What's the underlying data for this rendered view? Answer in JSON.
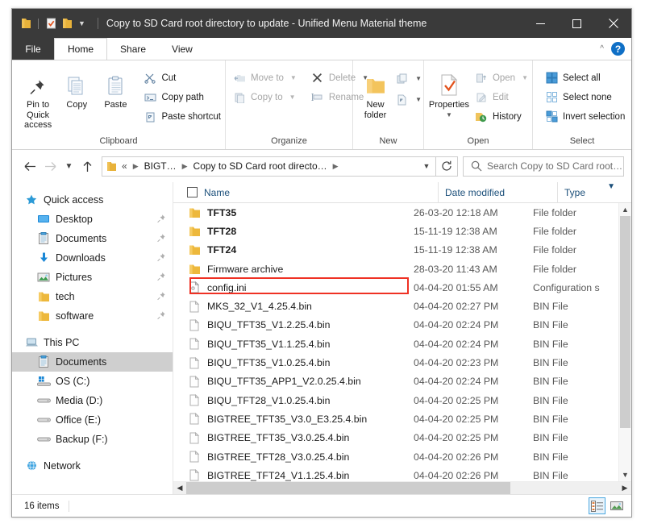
{
  "window": {
    "title": "Copy to SD Card root directory to update - Unified Menu Material theme",
    "quick_access_icons": [
      "folder-icon",
      "properties-icon",
      "new-folder-icon",
      "customize-qat-chevron-icon"
    ],
    "buttons": {
      "minimize": "minimize-button",
      "maximize": "maximize-button",
      "close": "close-button"
    }
  },
  "ribbon": {
    "tabs": [
      {
        "label": "File"
      },
      {
        "label": "Home"
      },
      {
        "label": "Share"
      },
      {
        "label": "View"
      }
    ],
    "collapse_label": "^",
    "help_label": "?",
    "groups": [
      {
        "label": "Clipboard",
        "big": [
          {
            "label": "Pin to Quick\naccess",
            "line1": "Pin to Quick",
            "line2": "access",
            "icon": "pin-icon"
          },
          {
            "label": "Copy",
            "line1": "Copy",
            "line2": "",
            "icon": "copy-icon"
          },
          {
            "label": "Paste",
            "line1": "Paste",
            "line2": "",
            "icon": "paste-icon"
          }
        ],
        "small": [
          {
            "label": "Cut",
            "icon": "scissors-icon",
            "disabled": false
          },
          {
            "label": "Copy path",
            "icon": "copy-path-icon",
            "disabled": false
          },
          {
            "label": "Paste shortcut",
            "icon": "paste-shortcut-icon",
            "disabled": false
          }
        ]
      },
      {
        "label": "Organize",
        "small_left": [
          {
            "label": "Move to",
            "icon": "move-to-icon",
            "dropdown": true,
            "disabled": true
          },
          {
            "label": "Copy to",
            "icon": "copy-to-icon",
            "dropdown": true,
            "disabled": true
          }
        ],
        "small_right": [
          {
            "label": "Delete",
            "icon": "delete-x-icon",
            "dropdown": true,
            "disabled": true
          },
          {
            "label": "Rename",
            "icon": "rename-icon",
            "dropdown": false,
            "disabled": true
          }
        ]
      },
      {
        "label": "New",
        "big": [
          {
            "line1": "New",
            "line2": "folder",
            "icon": "new-folder-icon"
          }
        ],
        "split": [
          {
            "icon": "new-item-icon",
            "dropdown": true
          },
          {
            "icon": "easy-access-icon",
            "dropdown": true
          }
        ]
      },
      {
        "label": "Open",
        "big": [
          {
            "line1": "Properties",
            "line2": "",
            "icon": "properties-icon",
            "dropdown": true
          }
        ],
        "small": [
          {
            "label": "Open",
            "icon": "open-icon",
            "dropdown": true,
            "disabled": true
          },
          {
            "label": "Edit",
            "icon": "edit-icon",
            "dropdown": false,
            "disabled": true
          },
          {
            "label": "History",
            "icon": "history-icon",
            "dropdown": false,
            "disabled": false
          }
        ]
      },
      {
        "label": "Select",
        "small": [
          {
            "label": "Select all",
            "icon": "select-all-icon"
          },
          {
            "label": "Select none",
            "icon": "select-none-icon"
          },
          {
            "label": "Invert selection",
            "icon": "invert-selection-icon"
          }
        ]
      }
    ]
  },
  "addressbar": {
    "back": "back-arrow-icon",
    "forward": "forward-arrow-icon",
    "recent": "recent-locations-chevron-icon",
    "up": "up-arrow-icon",
    "folder_icon": "folder-icon",
    "overflow": "«",
    "crumbs": [
      "BIGT…",
      "Copy to SD Card root directo…"
    ],
    "dropdown": "address-dropdown-icon",
    "refresh": "refresh-icon",
    "search": {
      "placeholder": "Search Copy to SD Card root…",
      "icon": "search-icon"
    }
  },
  "navpane": {
    "items": [
      {
        "label": "Quick access",
        "icon": "quick-access-star-icon",
        "level": 0,
        "pinned": false,
        "selected": false
      },
      {
        "label": "Desktop",
        "icon": "desktop-icon",
        "level": 1,
        "pinned": true,
        "selected": false
      },
      {
        "label": "Documents",
        "icon": "documents-icon",
        "level": 1,
        "pinned": true,
        "selected": false
      },
      {
        "label": "Downloads",
        "icon": "downloads-icon",
        "level": 1,
        "pinned": true,
        "selected": false
      },
      {
        "label": "Pictures",
        "icon": "pictures-icon",
        "level": 1,
        "pinned": true,
        "selected": false
      },
      {
        "label": "tech",
        "icon": "folder-icon",
        "level": 1,
        "pinned": true,
        "selected": false
      },
      {
        "label": "software",
        "icon": "folder-icon",
        "level": 1,
        "pinned": true,
        "selected": false
      },
      {
        "gap": true
      },
      {
        "label": "This PC",
        "icon": "this-pc-icon",
        "level": 0,
        "pinned": false,
        "selected": false
      },
      {
        "label": "Documents",
        "icon": "documents-icon",
        "level": 1,
        "pinned": false,
        "selected": true
      },
      {
        "label": "OS (C:)",
        "icon": "windows-drive-icon",
        "level": 1,
        "pinned": false,
        "selected": false
      },
      {
        "label": "Media (D:)",
        "icon": "drive-icon",
        "level": 1,
        "pinned": false,
        "selected": false
      },
      {
        "label": "Office (E:)",
        "icon": "drive-icon",
        "level": 1,
        "pinned": false,
        "selected": false
      },
      {
        "label": "Backup (F:)",
        "icon": "drive-icon",
        "level": 1,
        "pinned": false,
        "selected": false
      },
      {
        "gap": true
      },
      {
        "label": "Network",
        "icon": "network-icon",
        "level": 0,
        "pinned": false,
        "selected": false
      }
    ]
  },
  "filelist": {
    "columns": [
      {
        "label": "Name"
      },
      {
        "label": "Date modified"
      },
      {
        "label": "Type"
      }
    ],
    "sort_indicator": "sort-ascending-icon",
    "select_all_checkbox": "select-all-checkbox",
    "rows": [
      {
        "name": "TFT35",
        "date": "26-03-20 12:18 AM",
        "type": "File folder",
        "icon": "folder-icon",
        "bold": true,
        "highlighted": false
      },
      {
        "name": "TFT28",
        "date": "15-11-19 12:38 AM",
        "type": "File folder",
        "icon": "folder-icon",
        "bold": true,
        "highlighted": false
      },
      {
        "name": "TFT24",
        "date": "15-11-19 12:38 AM",
        "type": "File folder",
        "icon": "folder-icon",
        "bold": true,
        "highlighted": false
      },
      {
        "name": "Firmware archive",
        "date": "28-03-20 11:43 AM",
        "type": "File folder",
        "icon": "folder-icon",
        "bold": false,
        "highlighted": false
      },
      {
        "name": "config.ini",
        "date": "04-04-20 01:55 AM",
        "type": "Configuration s",
        "icon": "ini-file-icon",
        "bold": false,
        "highlighted": true
      },
      {
        "name": "MKS_32_V1_4.25.4.bin",
        "date": "04-04-20 02:27 PM",
        "type": "BIN File",
        "icon": "bin-file-icon",
        "bold": false,
        "highlighted": false
      },
      {
        "name": "BIQU_TFT35_V1.2.25.4.bin",
        "date": "04-04-20 02:24 PM",
        "type": "BIN File",
        "icon": "bin-file-icon",
        "bold": false,
        "highlighted": false
      },
      {
        "name": "BIQU_TFT35_V1.1.25.4.bin",
        "date": "04-04-20 02:24 PM",
        "type": "BIN File",
        "icon": "bin-file-icon",
        "bold": false,
        "highlighted": false
      },
      {
        "name": "BIQU_TFT35_V1.0.25.4.bin",
        "date": "04-04-20 02:23 PM",
        "type": "BIN File",
        "icon": "bin-file-icon",
        "bold": false,
        "highlighted": false
      },
      {
        "name": "BIQU_TFT35_APP1_V2.0.25.4.bin",
        "date": "04-04-20 02:24 PM",
        "type": "BIN File",
        "icon": "bin-file-icon",
        "bold": false,
        "highlighted": false
      },
      {
        "name": "BIQU_TFT28_V1.0.25.4.bin",
        "date": "04-04-20 02:25 PM",
        "type": "BIN File",
        "icon": "bin-file-icon",
        "bold": false,
        "highlighted": false
      },
      {
        "name": "BIGTREE_TFT35_V3.0_E3.25.4.bin",
        "date": "04-04-20 02:25 PM",
        "type": "BIN File",
        "icon": "bin-file-icon",
        "bold": false,
        "highlighted": false
      },
      {
        "name": "BIGTREE_TFT35_V3.0.25.4.bin",
        "date": "04-04-20 02:25 PM",
        "type": "BIN File",
        "icon": "bin-file-icon",
        "bold": false,
        "highlighted": false
      },
      {
        "name": "BIGTREE_TFT28_V3.0.25.4.bin",
        "date": "04-04-20 02:26 PM",
        "type": "BIN File",
        "icon": "bin-file-icon",
        "bold": false,
        "highlighted": false
      },
      {
        "name": "BIGTREE_TFT24_V1.1.25.4.bin",
        "date": "04-04-20 02:26 PM",
        "type": "BIN File",
        "icon": "bin-file-icon",
        "bold": false,
        "highlighted": false
      }
    ]
  },
  "statusbar": {
    "item_count": "16 items",
    "views": [
      {
        "icon": "details-view-icon",
        "active": true
      },
      {
        "icon": "large-icons-view-icon",
        "active": false
      }
    ]
  },
  "colors": {
    "titlebar_bg": "#3a3a3a",
    "accent_blue": "#0f6fc6",
    "highlight_red": "#ef3124",
    "header_text": "#1b4f7a",
    "folder_yellow": "#f7c662"
  }
}
